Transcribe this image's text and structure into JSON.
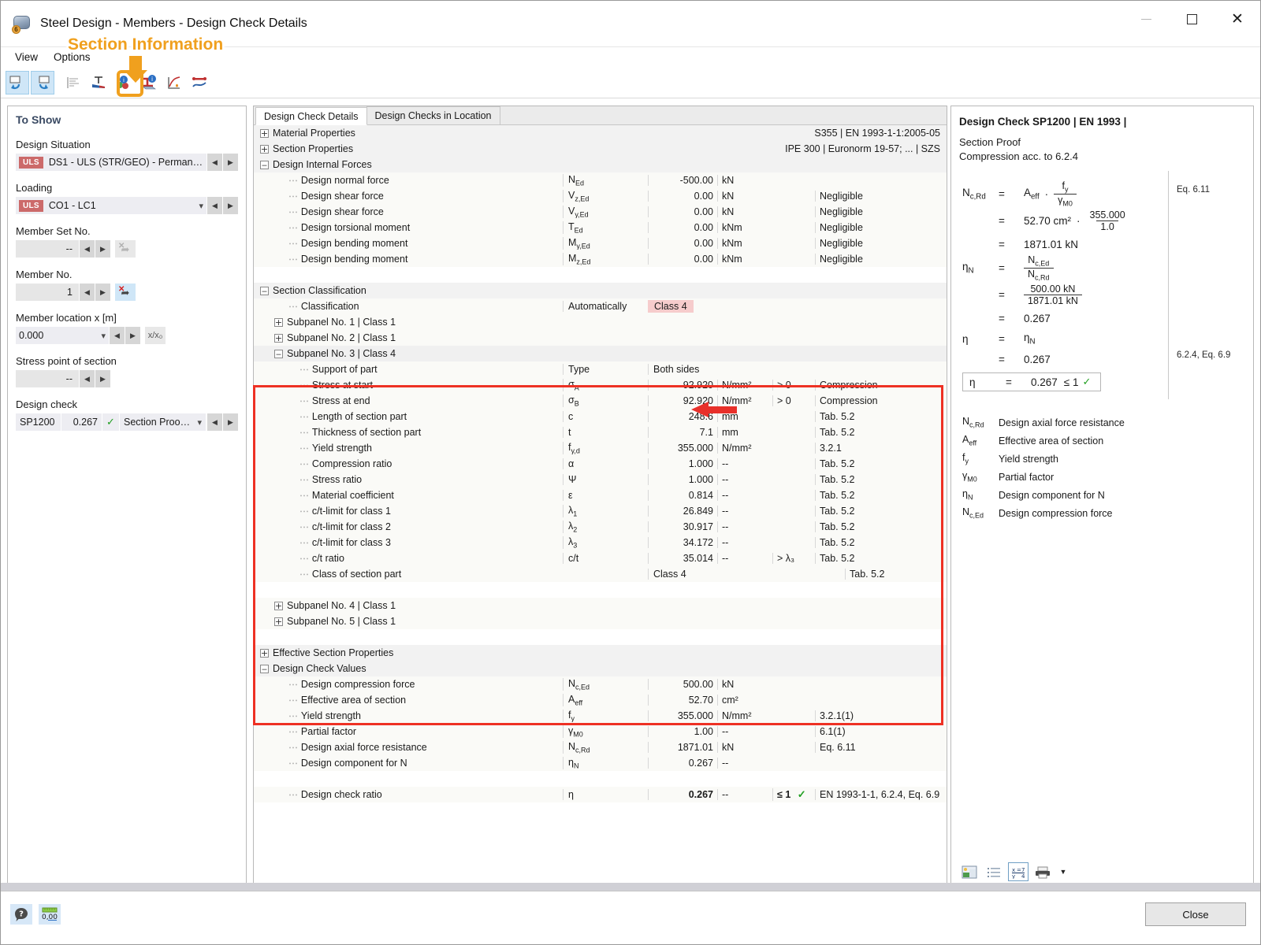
{
  "window": {
    "title": "Steel Design - Members - Design Check Details",
    "minimize_label": "",
    "maximize_label": "",
    "close_label": "✕"
  },
  "callout": {
    "text": "Section Information"
  },
  "menu": {
    "items": [
      "View",
      "Options"
    ]
  },
  "toolbar": {
    "buttons": [
      {
        "name": "previous-view-icon"
      },
      {
        "name": "next-view-icon"
      },
      {
        "name": "result-diagram-icon"
      },
      {
        "name": "stress-distribution-icon"
      },
      {
        "name": "material-information-icon"
      },
      {
        "name": "section-information-icon"
      },
      {
        "name": "fire-design-icon"
      },
      {
        "name": "member-result-icon"
      }
    ]
  },
  "left": {
    "title": "To Show",
    "design_situation": {
      "label": "Design Situation",
      "tag": "ULS",
      "value": "DS1 - ULS (STR/GEO) - Permane..."
    },
    "loading": {
      "label": "Loading",
      "tag": "ULS",
      "value": "CO1 - LC1"
    },
    "member_set_no": {
      "label": "Member Set No.",
      "value": "--"
    },
    "member_no": {
      "label": "Member No.",
      "value": "1"
    },
    "member_location": {
      "label": "Member location x [m]",
      "value": "0.000",
      "unit_btn": "x/x₀"
    },
    "stress_point": {
      "label": "Stress point of section",
      "value": "--"
    },
    "design_check": {
      "label": "Design check",
      "id": "SP1200",
      "ratio": "0.267",
      "check": "✓",
      "description": "Section Proof | C..."
    }
  },
  "center": {
    "tabs": [
      {
        "label": "Design Check Details",
        "selected": true
      },
      {
        "label": "Design Checks in Location",
        "selected": false
      }
    ],
    "groups": [
      {
        "name": "material-properties",
        "label": "Material Properties",
        "expanded": false,
        "summary": "S355 | EN 1993-1-1:2005-05"
      },
      {
        "name": "section-properties",
        "label": "Section Properties",
        "expanded": false,
        "summary": "IPE 300 | Euronorm 19-57; ... | SZS"
      }
    ],
    "design_internal_forces": {
      "label": "Design Internal Forces",
      "rows": [
        {
          "label": "Design normal force",
          "sym": "Nₑₑ",
          "sym_base": "N",
          "sym_sub": "Ed",
          "val": "-500.00",
          "unit": "kN",
          "cond": "",
          "ref": ""
        },
        {
          "label": "Design shear force",
          "sym_base": "V",
          "sym_sub": "z,Ed",
          "val": "0.00",
          "unit": "kN",
          "cond": "",
          "ref": "Negligible"
        },
        {
          "label": "Design shear force",
          "sym_base": "V",
          "sym_sub": "y,Ed",
          "val": "0.00",
          "unit": "kN",
          "cond": "",
          "ref": "Negligible"
        },
        {
          "label": "Design torsional moment",
          "sym_base": "T",
          "sym_sub": "Ed",
          "val": "0.00",
          "unit": "kNm",
          "cond": "",
          "ref": "Negligible"
        },
        {
          "label": "Design bending moment",
          "sym_base": "M",
          "sym_sub": "y,Ed",
          "val": "0.00",
          "unit": "kNm",
          "cond": "",
          "ref": "Negligible"
        },
        {
          "label": "Design bending moment",
          "sym_base": "M",
          "sym_sub": "z,Ed",
          "val": "0.00",
          "unit": "kNm",
          "cond": "",
          "ref": "Negligible"
        }
      ]
    },
    "section_classification": {
      "label": "Section Classification",
      "classification_row": {
        "label": "Classification",
        "mode": "Automatically",
        "result": "Class 4"
      },
      "subpanels": [
        {
          "label": "Subpanel No. 1 | Class 1",
          "expanded": false
        },
        {
          "label": "Subpanel No. 2 | Class 1",
          "expanded": false
        },
        {
          "label": "Subpanel No. 3 | Class 4",
          "expanded": true
        },
        {
          "label": "Subpanel No. 4 | Class 1",
          "expanded": false
        },
        {
          "label": "Subpanel No. 5 | Class 1",
          "expanded": false
        }
      ],
      "subpanel3_rows": [
        {
          "label": "Support of part",
          "sym_base": "Type",
          "sym_sub": "",
          "wide": "Both sides",
          "val": "",
          "unit": "",
          "cond": "",
          "ref": ""
        },
        {
          "label": "Stress at start",
          "sym_base": "σ",
          "sym_sub": "A",
          "val": "92.920",
          "unit": "N/mm²",
          "cond": "> 0",
          "ref": "Compression"
        },
        {
          "label": "Stress at end",
          "sym_base": "σ",
          "sym_sub": "B",
          "val": "92.920",
          "unit": "N/mm²",
          "cond": "> 0",
          "ref": "Compression"
        },
        {
          "label": "Length of section part",
          "sym_base": "c",
          "sym_sub": "",
          "val": "248.6",
          "unit": "mm",
          "cond": "",
          "ref": "Tab. 5.2"
        },
        {
          "label": "Thickness of section part",
          "sym_base": "t",
          "sym_sub": "",
          "val": "7.1",
          "unit": "mm",
          "cond": "",
          "ref": "Tab. 5.2"
        },
        {
          "label": "Yield strength",
          "sym_base": "f",
          "sym_sub": "y,d",
          "val": "355.000",
          "unit": "N/mm²",
          "cond": "",
          "ref": "3.2.1"
        },
        {
          "label": "Compression ratio",
          "sym_base": "α",
          "sym_sub": "",
          "val": "1.000",
          "unit": "--",
          "cond": "",
          "ref": "Tab. 5.2"
        },
        {
          "label": "Stress ratio",
          "sym_base": "Ψ",
          "sym_sub": "",
          "val": "1.000",
          "unit": "--",
          "cond": "",
          "ref": "Tab. 5.2"
        },
        {
          "label": "Material coefficient",
          "sym_base": "ε",
          "sym_sub": "",
          "val": "0.814",
          "unit": "--",
          "cond": "",
          "ref": "Tab. 5.2"
        },
        {
          "label": "c/t-limit for class 1",
          "sym_base": "λ",
          "sym_sub": "1",
          "val": "26.849",
          "unit": "--",
          "cond": "",
          "ref": "Tab. 5.2"
        },
        {
          "label": "c/t-limit for class 2",
          "sym_base": "λ",
          "sym_sub": "2",
          "val": "30.917",
          "unit": "--",
          "cond": "",
          "ref": "Tab. 5.2"
        },
        {
          "label": "c/t-limit for class 3",
          "sym_base": "λ",
          "sym_sub": "3",
          "val": "34.172",
          "unit": "--",
          "cond": "",
          "ref": "Tab. 5.2"
        },
        {
          "label": "c/t ratio",
          "sym_base": "c/t",
          "sym_sub": "",
          "val": "35.014",
          "unit": "--",
          "cond": "> λ₃",
          "ref": "Tab. 5.2"
        },
        {
          "label": "Class of section part",
          "sym_base": "",
          "sym_sub": "",
          "wide": "Class 4",
          "val": "",
          "unit": "",
          "cond": "",
          "ref": "Tab. 5.2"
        }
      ]
    },
    "effective_section_properties": {
      "label": "Effective Section Properties",
      "expanded": false
    },
    "design_check_values": {
      "label": "Design Check Values",
      "rows": [
        {
          "label": "Design compression force",
          "sym_base": "N",
          "sym_sub": "c,Ed",
          "val": "500.00",
          "unit": "kN",
          "cond": "",
          "ref": ""
        },
        {
          "label": "Effective area of section",
          "sym_base": "A",
          "sym_sub": "eff",
          "val": "52.70",
          "unit": "cm²",
          "cond": "",
          "ref": ""
        },
        {
          "label": "Yield strength",
          "sym_base": "f",
          "sym_sub": "y",
          "val": "355.000",
          "unit": "N/mm²",
          "cond": "",
          "ref": "3.2.1(1)"
        },
        {
          "label": "Partial factor",
          "sym_base": "γ",
          "sym_sub": "M0",
          "val": "1.00",
          "unit": "--",
          "cond": "",
          "ref": "6.1(1)"
        },
        {
          "label": "Design axial force resistance",
          "sym_base": "N",
          "sym_sub": "c,Rd",
          "val": "1871.01",
          "unit": "kN",
          "cond": "",
          "ref": "Eq. 6.11"
        },
        {
          "label": "Design component for N",
          "sym_base": "η",
          "sym_sub": "N",
          "val": "0.267",
          "unit": "--",
          "cond": "",
          "ref": ""
        }
      ],
      "final_row": {
        "label": "Design check ratio",
        "sym_base": "η",
        "sym_sub": "",
        "val": "0.267",
        "unit": "--",
        "cond": "≤ 1",
        "check": "✓",
        "ref": "EN 1993-1-1, 6.2.4, Eq. 6.9"
      }
    }
  },
  "right": {
    "title": "Design Check SP1200 | EN 1993 |",
    "subtitle_line1": "Section Proof",
    "subtitle_line2": "Compression acc. to 6.2.4",
    "eq_ref_1": "Eq. 6.11",
    "eq_ref_2": "6.2.4, Eq. 6.9",
    "formula": {
      "r1_sym_base": "N",
      "r1_sym_sub": "c,Rd",
      "r1_a_base": "A",
      "r1_a_sub": "eff",
      "r1_num_base": "f",
      "r1_num_sub": "y",
      "r1_den_base": "γ",
      "r1_den_sub": "M0",
      "r2_area": "52.70 cm²",
      "r2_num": "355.000",
      "r2_den": "1.0",
      "r3_result": "1871.01 kN",
      "r4_sym_base": "η",
      "r4_sym_sub": "N",
      "r4_num_base": "N",
      "r4_num_sub": "c,Ed",
      "r4_den_base": "N",
      "r4_den_sub": "c,Rd",
      "r5_num": "500.00 kN",
      "r5_den": "1871.01 kN",
      "r6_result": "0.267",
      "r7_sym": "η",
      "r7_val_base": "η",
      "r7_val_sub": "N",
      "r8_result": "0.267",
      "box_sym": "η",
      "box_value": "0.267",
      "box_limit": "≤ 1",
      "box_check": "✓"
    },
    "legend": [
      {
        "sym_base": "N",
        "sym_sub": "c,Rd",
        "text": "Design axial force resistance"
      },
      {
        "sym_base": "A",
        "sym_sub": "eff",
        "text": "Effective area of section"
      },
      {
        "sym_base": "f",
        "sym_sub": "y",
        "text": "Yield strength"
      },
      {
        "sym_base": "γ",
        "sym_sub": "M0",
        "text": "Partial factor"
      },
      {
        "sym_base": "η",
        "sym_sub": "N",
        "text": "Design component for N"
      },
      {
        "sym_base": "N",
        "sym_sub": "c,Ed",
        "text": "Design compression force"
      }
    ],
    "toolbar_buttons": [
      {
        "name": "picture-icon"
      },
      {
        "name": "list-icon"
      },
      {
        "name": "formula-values-icon"
      },
      {
        "name": "print-icon"
      },
      {
        "name": "dropdown-arrow-icon"
      }
    ]
  },
  "footer": {
    "help_icon": "?",
    "units_icon": "0,00",
    "close_label": "Close"
  }
}
